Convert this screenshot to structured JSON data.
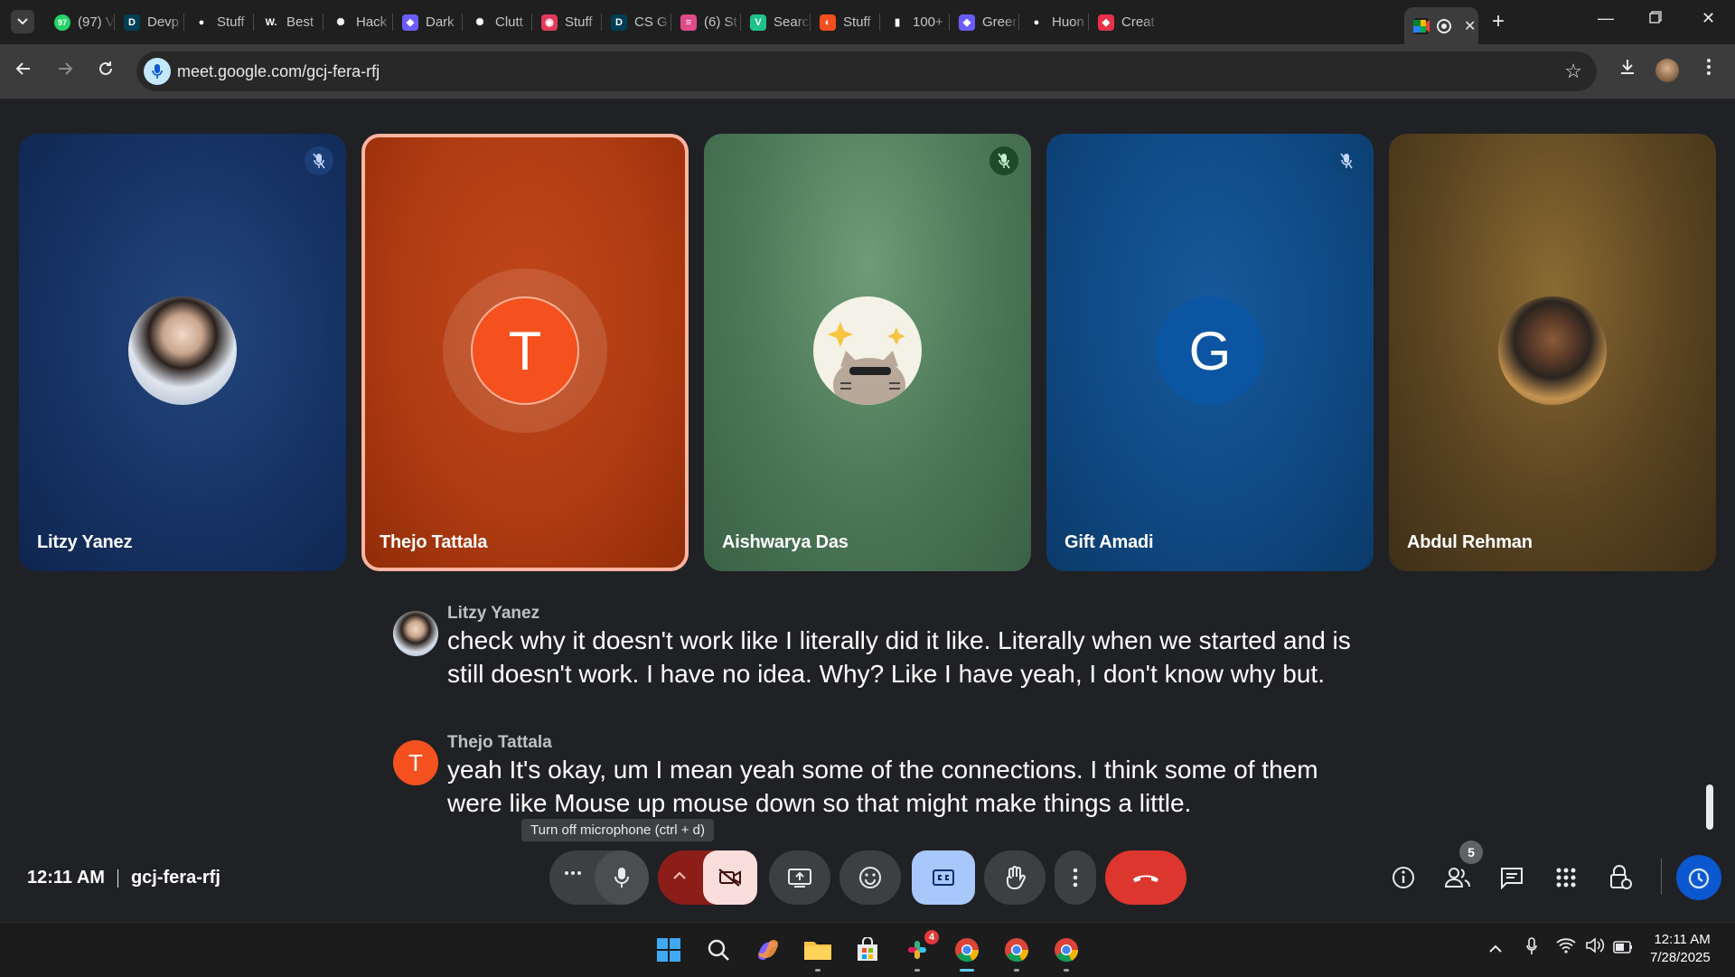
{
  "browser": {
    "tabs": [
      {
        "label": "(97) V",
        "icon": "whatsapp-icon",
        "badge": "97",
        "color": "#25d366"
      },
      {
        "label": "Devp",
        "icon": "devpost-icon",
        "color": "#003e54"
      },
      {
        "label": "Stuff",
        "icon": "github-icon",
        "color": "#1f1f1f"
      },
      {
        "label": "Best",
        "icon": "wikipedia-icon",
        "color": "#1f1f1f"
      },
      {
        "label": "Hack",
        "icon": "chatgpt-icon",
        "color": "#1f1f1f"
      },
      {
        "label": "Dark",
        "icon": "copilot-icon",
        "color": "#6b5cff"
      },
      {
        "label": "Clutt",
        "icon": "chatgpt-icon",
        "color": "#1f1f1f"
      },
      {
        "label": "Stuff",
        "icon": "cube-icon",
        "color": "#e03a5a"
      },
      {
        "label": "CS G",
        "icon": "devpost-icon",
        "color": "#003e54"
      },
      {
        "label": "(6) St",
        "icon": "stack-icon",
        "color": "#e04a8a"
      },
      {
        "label": "Searc",
        "icon": "vercel-v-icon",
        "color": "#1ec28b"
      },
      {
        "label": "Stuff",
        "icon": "figma-icon",
        "color": "#f24e1e"
      },
      {
        "label": "100+",
        "icon": "bars-icon",
        "color": "#1f1f1f"
      },
      {
        "label": "Greer",
        "icon": "copilot-icon",
        "color": "#6b5cff"
      },
      {
        "label": "Huon",
        "icon": "github-icon",
        "color": "#1f1f1f"
      },
      {
        "label": "Creat",
        "icon": "gemini-icon",
        "color": "#e8304a"
      }
    ],
    "active_tab_icon": "meet-recording-icon",
    "url": "meet.google.com/gcj-fera-rfj"
  },
  "participants": [
    {
      "name": "Litzy Yanez",
      "muted": true,
      "avatar": "photo-woman",
      "bg": "#163364"
    },
    {
      "name": "Thejo Tattala",
      "muted": false,
      "avatar_letter": "T",
      "bg": "#b13c12",
      "speaking": true
    },
    {
      "name": "Aishwarya Das",
      "muted": true,
      "avatar": "pusheen-cat",
      "bg": "#4d7a58"
    },
    {
      "name": "Gift Amadi",
      "muted": true,
      "avatar_letter": "G",
      "bg": "#0f4a84"
    },
    {
      "name": "Abdul Rehman",
      "muted": false,
      "avatar": "photo-man",
      "bg": "#5a4420"
    }
  ],
  "captions": [
    {
      "speaker": "Litzy Yanez",
      "text": "check why it doesn't work like I literally did it like. Literally when we started and is still doesn't work. I have no idea. Why? Like I have yeah, I don't know why but."
    },
    {
      "speaker": "Thejo Tattala",
      "avatar_letter": "T",
      "text": "yeah It's okay, um I mean yeah some of the connections. I think some of them were like Mouse up mouse down so that might make things a little."
    }
  ],
  "tooltip": "Turn off microphone (ctrl + d)",
  "meeting": {
    "time": "12:11 AM",
    "code": "gcj-fera-rfj"
  },
  "people_count": "5",
  "taskbar": {
    "slack_badge": "4",
    "time": "12:11 AM",
    "date": "7/28/2025"
  }
}
